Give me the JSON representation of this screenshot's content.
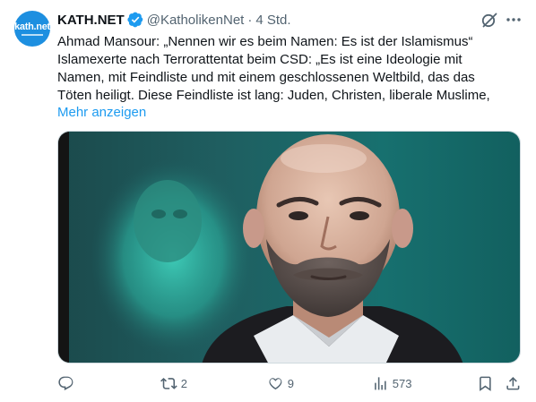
{
  "author": {
    "avatar_text": "kath.net",
    "name": "KATH.NET",
    "handle": "@KatholikenNet",
    "separator": "·",
    "time": "4 Std."
  },
  "tweet": {
    "lines": [
      "Ahmad Mansour: „Nennen wir es beim Namen: Es ist der Islamismus“",
      "Islamexerte nach Terrorattentat beim CSD: „Es ist eine Ideologie mit",
      "Namen, mit Feindliste und mit einem geschlossenen Weltbild, das das",
      "Töten heiligt. Diese Feindliste ist lang: Juden, Christen, liberale Muslime,"
    ],
    "show_more": "Mehr anzeigen"
  },
  "actions": {
    "replies": "",
    "reposts": "2",
    "likes": "9",
    "views": "573"
  },
  "icons": {
    "verified": "verified-badge-icon",
    "grok": "grok-icon",
    "more": "more-icon",
    "reply": "reply-icon",
    "repost": "repost-icon",
    "like": "heart-icon",
    "views": "views-icon",
    "bookmark": "bookmark-icon",
    "share": "share-icon"
  },
  "colors": {
    "accent": "#1d9bf0",
    "secondary_text": "#536471",
    "avatar_bg": "#1d8fe0"
  }
}
